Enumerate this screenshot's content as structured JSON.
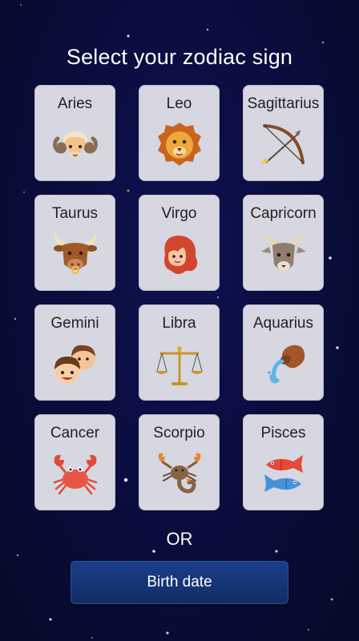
{
  "header": {
    "title": "Select your zodiac sign"
  },
  "signs": [
    {
      "label": "Aries",
      "icon": "ram-icon"
    },
    {
      "label": "Leo",
      "icon": "lion-icon"
    },
    {
      "label": "Sagittarius",
      "icon": "bow-arrow-icon"
    },
    {
      "label": "Taurus",
      "icon": "bull-icon"
    },
    {
      "label": "Virgo",
      "icon": "maiden-icon"
    },
    {
      "label": "Capricorn",
      "icon": "goat-icon"
    },
    {
      "label": "Gemini",
      "icon": "twins-icon"
    },
    {
      "label": "Libra",
      "icon": "scales-icon"
    },
    {
      "label": "Aquarius",
      "icon": "water-jug-icon"
    },
    {
      "label": "Cancer",
      "icon": "crab-icon"
    },
    {
      "label": "Scorpio",
      "icon": "scorpion-icon"
    },
    {
      "label": "Pisces",
      "icon": "fish-icon"
    }
  ],
  "divider": {
    "or_label": "OR"
  },
  "actions": {
    "birth_date_label": "Birth date"
  },
  "colors": {
    "background": "#0a0c3c",
    "card": "#d6d7e0",
    "button": "#163476"
  }
}
